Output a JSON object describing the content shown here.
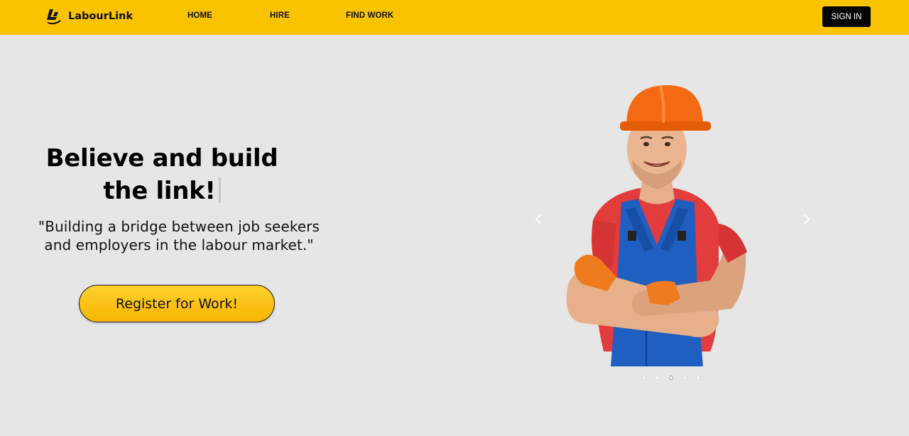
{
  "brand": {
    "name": "LabourLink",
    "logo_icon": "labourlink-logo-icon"
  },
  "nav": {
    "items": [
      {
        "label": "HOME"
      },
      {
        "label": "HIRE"
      },
      {
        "label": "FIND WORK"
      }
    ],
    "signin_label": "SIGN IN"
  },
  "hero": {
    "title_line1": "Believe and build",
    "title_line2": "the link!",
    "subtitle_line1": "\"Building a bridge between job seekers",
    "subtitle_line2": "and employers in the labour market.\"",
    "cta_label": "Register for Work!"
  },
  "carousel": {
    "slide_count": 5,
    "active_slide": 3,
    "prev_icon": "chevron-left-icon",
    "next_icon": "chevron-right-icon"
  },
  "colors": {
    "navbar": "#fac300",
    "page_background": "#e6e6e6",
    "signin_button": "#050505",
    "cta_gradient_top": "#fcd12e",
    "cta_gradient_bottom": "#f8b500"
  }
}
